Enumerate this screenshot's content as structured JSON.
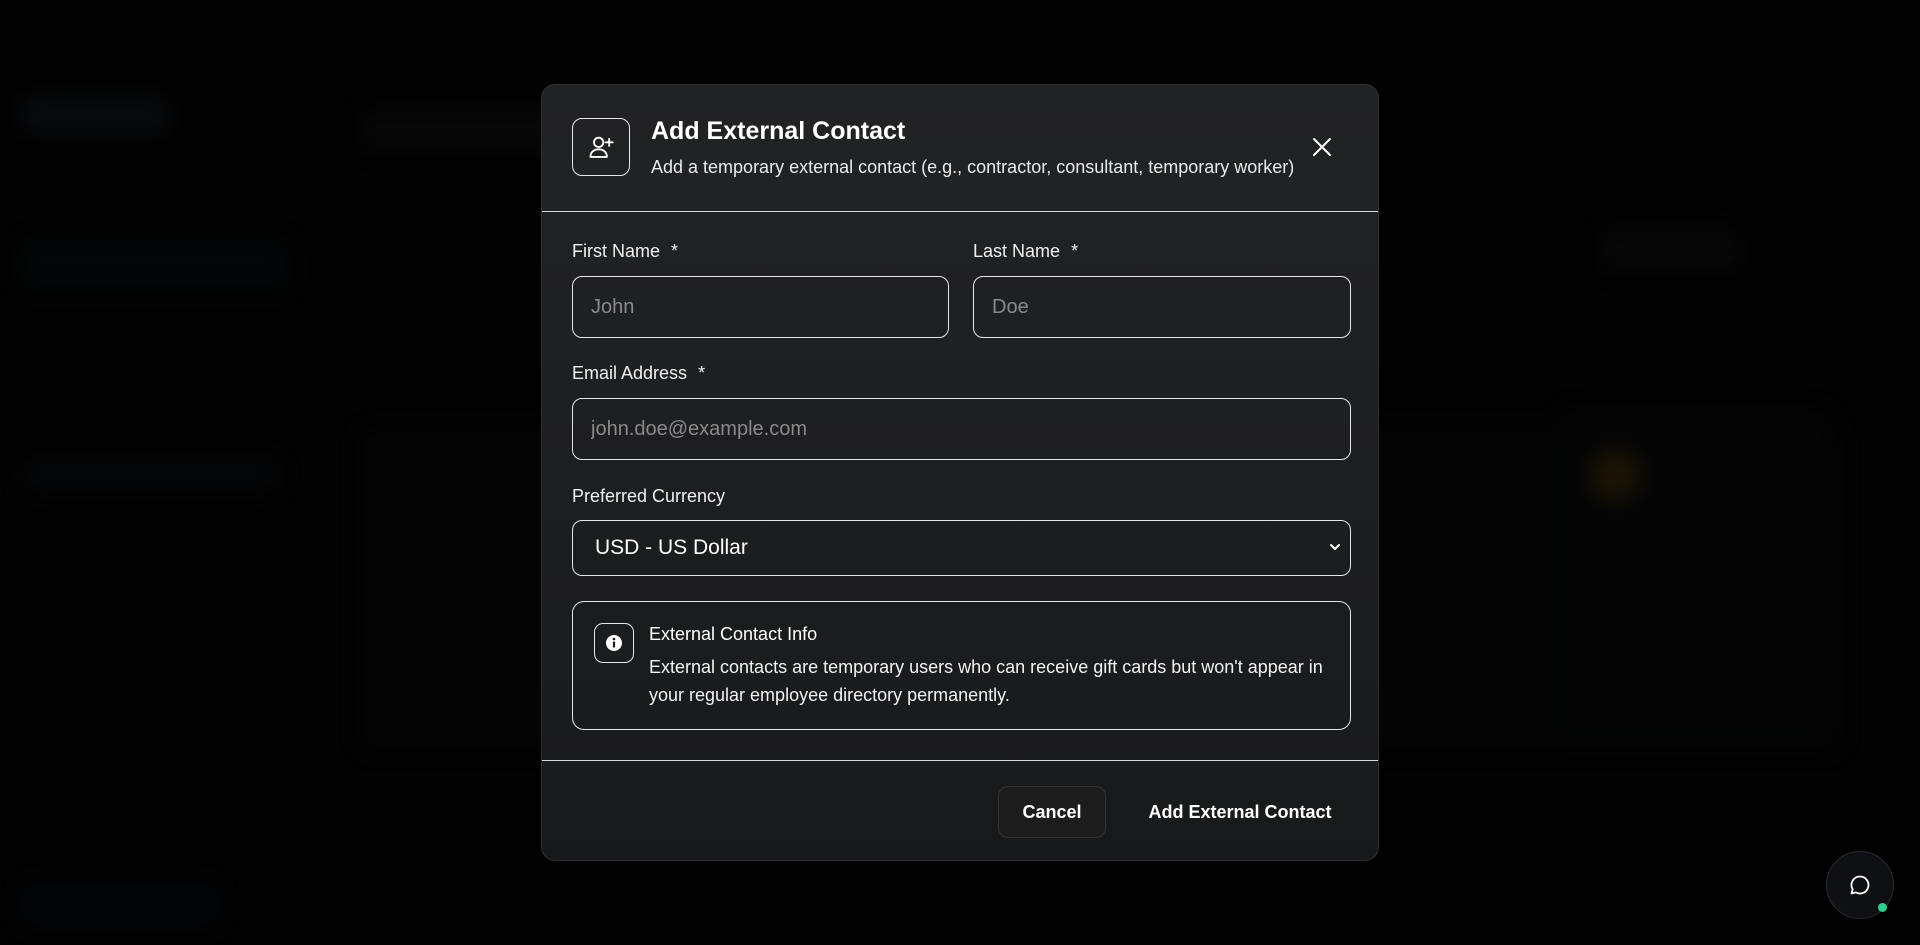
{
  "modal": {
    "title": "Add External Contact",
    "subtitle": "Add a temporary external contact (e.g., contractor, consultant, temporary worker)",
    "header_icon": "user-plus-icon",
    "close_icon": "close-icon"
  },
  "form": {
    "first_name": {
      "label": "First Name",
      "required_mark": "*",
      "placeholder": "John",
      "value": ""
    },
    "last_name": {
      "label": "Last Name",
      "required_mark": "*",
      "placeholder": "Doe",
      "value": ""
    },
    "email": {
      "label": "Email Address",
      "required_mark": "*",
      "placeholder": "john.doe@example.com",
      "value": ""
    },
    "currency": {
      "label": "Preferred Currency",
      "selected": "USD - US Dollar"
    }
  },
  "info": {
    "icon": "info-icon",
    "title": "External Contact Info",
    "text": "External contacts are temporary users who can receive gift cards but won't appear in your regular employee directory permanently."
  },
  "footer": {
    "cancel_label": "Cancel",
    "submit_label": "Add External Contact"
  },
  "chat": {
    "icon": "chat-icon",
    "status_color": "#2bd18e"
  },
  "colors": {
    "modal_background": "#1f2022",
    "border": "#e6e6e6",
    "placeholder": "#8a8a8a",
    "backdrop": "#050505"
  }
}
